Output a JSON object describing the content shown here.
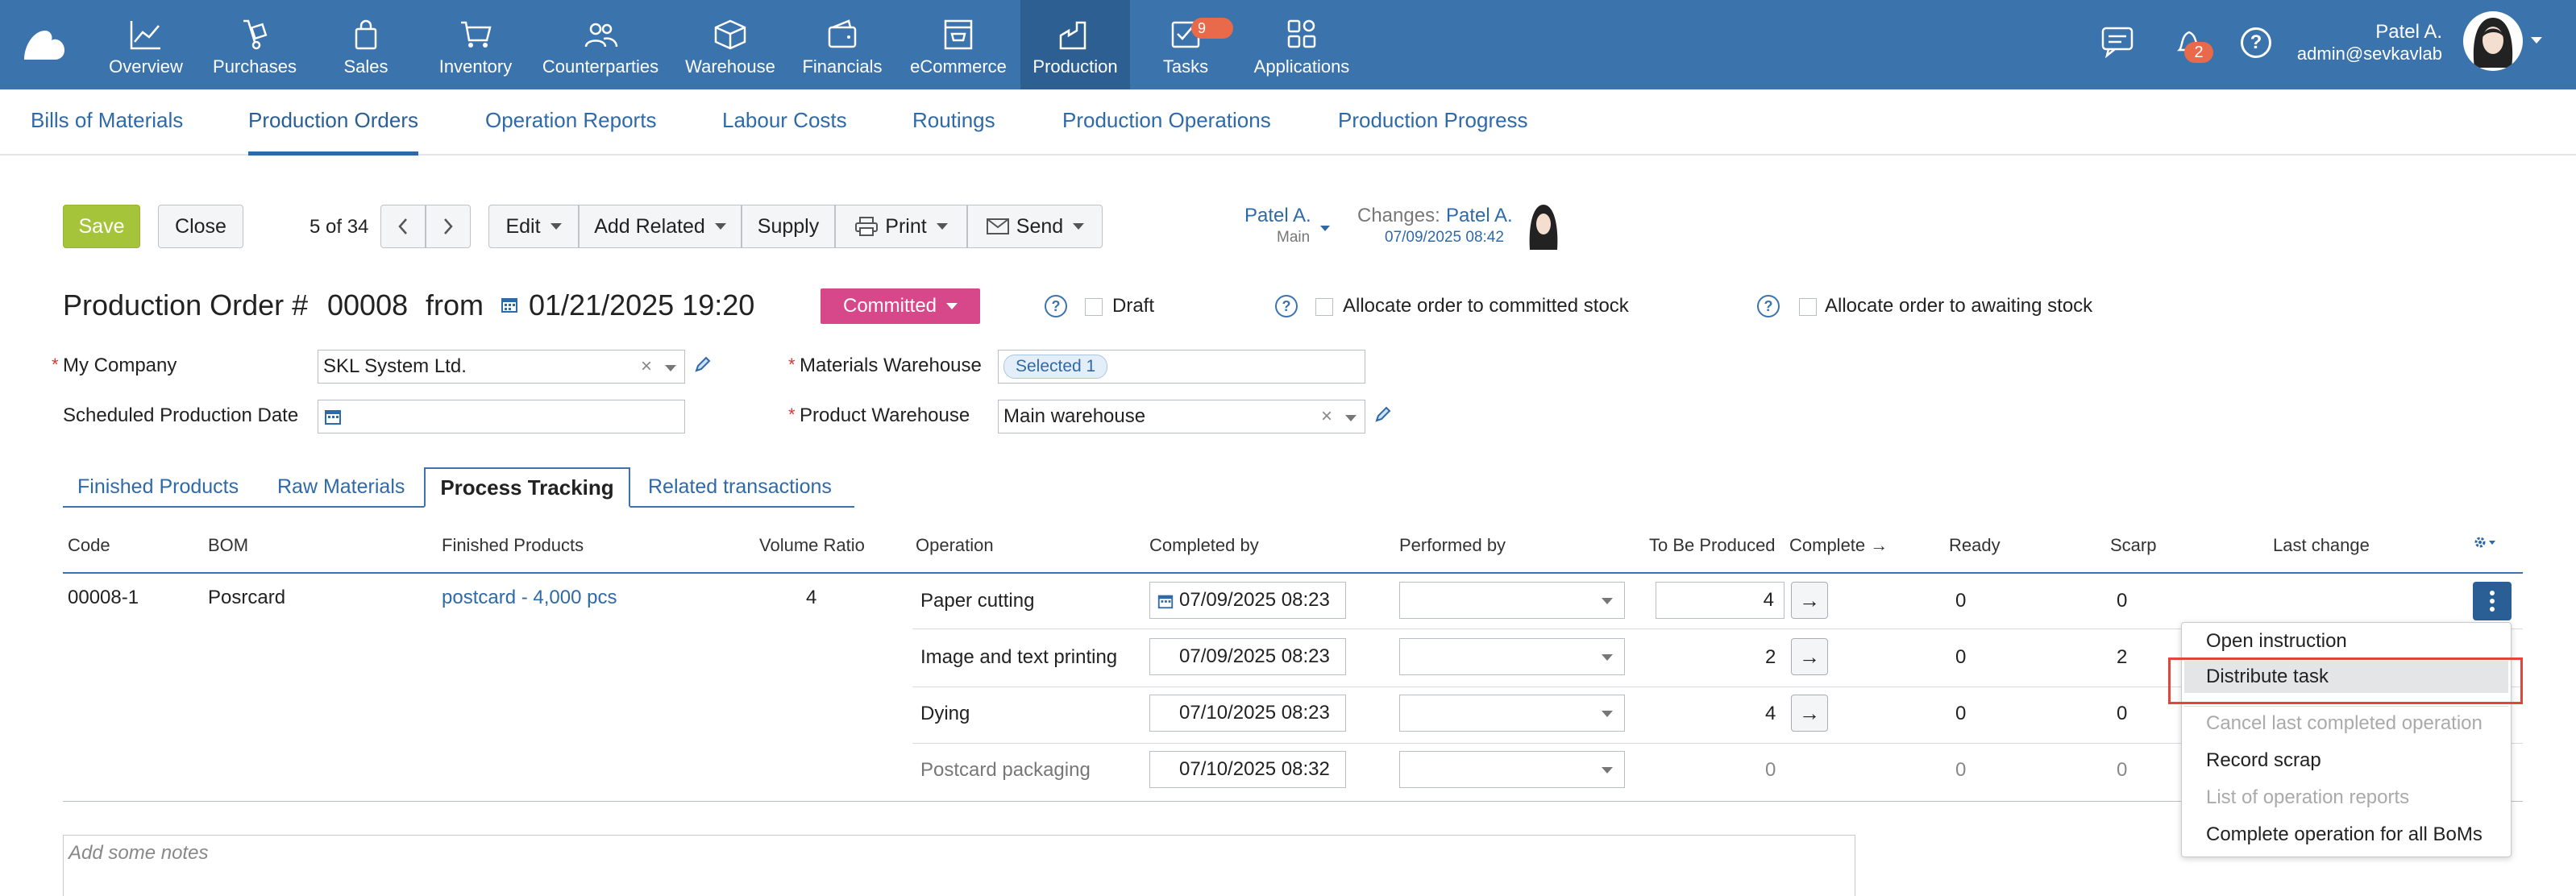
{
  "nav": {
    "items": [
      {
        "label": "Overview",
        "icon": "chart-line-icon"
      },
      {
        "label": "Purchases",
        "icon": "dolly-icon"
      },
      {
        "label": "Sales",
        "icon": "shopping-bag-icon"
      },
      {
        "label": "Inventory",
        "icon": "cart-icon"
      },
      {
        "label": "Counterparties",
        "icon": "users-icon"
      },
      {
        "label": "Warehouse",
        "icon": "box-icon"
      },
      {
        "label": "Financials",
        "icon": "wallet-icon"
      },
      {
        "label": "eCommerce",
        "icon": "storefront-icon"
      },
      {
        "label": "Production",
        "icon": "factory-icon"
      },
      {
        "label": "Tasks",
        "icon": "tasks-icon"
      },
      {
        "label": "Applications",
        "icon": "apps-grid-icon"
      }
    ],
    "tasks_badge": "9",
    "notifications_badge": "2",
    "user_name": "Patel A.",
    "user_email": "admin@sevkavlab"
  },
  "subnav": {
    "tabs": [
      "Bills of Materials",
      "Production Orders",
      "Operation Reports",
      "Labour Costs",
      "Routings",
      "Production Operations",
      "Production Progress"
    ]
  },
  "toolbar": {
    "save": "Save",
    "close": "Close",
    "record_counter": "5 of 34",
    "edit": "Edit",
    "add_related": "Add Related",
    "supply": "Supply",
    "print": "Print",
    "send": "Send",
    "responsible_name": "Patel A.",
    "responsible_role": "Main",
    "changes_label": "Changes:",
    "changes_user": "Patel A.",
    "changes_time": "07/09/2025 08:42"
  },
  "order": {
    "title": "Production Order #",
    "number": "00008",
    "from_label": "from",
    "date": "01/21/2025 19:20",
    "status": "Committed",
    "draft_label": "Draft",
    "allocate_committed_label": "Allocate order to committed stock",
    "allocate_awaiting_label": "Allocate order to awaiting stock"
  },
  "form": {
    "required_mark": "*",
    "my_company_label": "My Company",
    "my_company_value": "SKL System Ltd.",
    "scheduled_date_label": "Scheduled Production Date",
    "materials_wh_label": "Materials Warehouse",
    "materials_wh_tag": "Selected 1",
    "product_wh_label": "Product Warehouse",
    "product_wh_value": "Main warehouse"
  },
  "tabs": [
    "Finished Products",
    "Raw Materials",
    "Process Tracking",
    "Related transactions"
  ],
  "table": {
    "headers": [
      "Code",
      "BOM",
      "Finished Products",
      "Volume Ratio",
      "Operation",
      "Completed by",
      "Performed by",
      "To Be Produced",
      "Complete",
      "Ready",
      "Scarp",
      "Last change"
    ],
    "row": {
      "code": "00008-1",
      "bom": "Posrcard",
      "finished_product": "postcard - 4,000 pcs",
      "volume_ratio": "4"
    },
    "operations": [
      {
        "name": "Paper cutting",
        "completed_by": "07/09/2025 08:23",
        "to_be_produced": "4",
        "ready": "0",
        "scrap": "0"
      },
      {
        "name": "Image and text printing",
        "completed_by": "07/09/2025 08:23",
        "to_be_produced": "2",
        "ready": "0",
        "scrap": "2"
      },
      {
        "name": "Dying",
        "completed_by": "07/10/2025 08:23",
        "to_be_produced": "4",
        "ready": "0",
        "scrap": "0"
      },
      {
        "name": "Postcard packaging",
        "completed_by": "07/10/2025 08:32",
        "to_be_produced": "0",
        "ready": "0",
        "scrap": "0"
      }
    ]
  },
  "context_menu": {
    "items": [
      {
        "label": "Open instruction",
        "enabled": true
      },
      {
        "label": "Distribute task",
        "enabled": true,
        "highlighted": true
      },
      {
        "label": "Cancel last completed operation",
        "enabled": false
      },
      {
        "label": "Record scrap",
        "enabled": true
      },
      {
        "label": "List of operation reports",
        "enabled": false
      },
      {
        "label": "Complete operation for all BoMs",
        "enabled": true
      }
    ]
  },
  "notes_placeholder": "Add some notes",
  "colors": {
    "nav_bg": "#3b73ac",
    "save_green": "#a6c43a",
    "committed_pink": "#d6488a",
    "link_blue": "#2f6aa8",
    "highlight_red": "#e0463a"
  }
}
